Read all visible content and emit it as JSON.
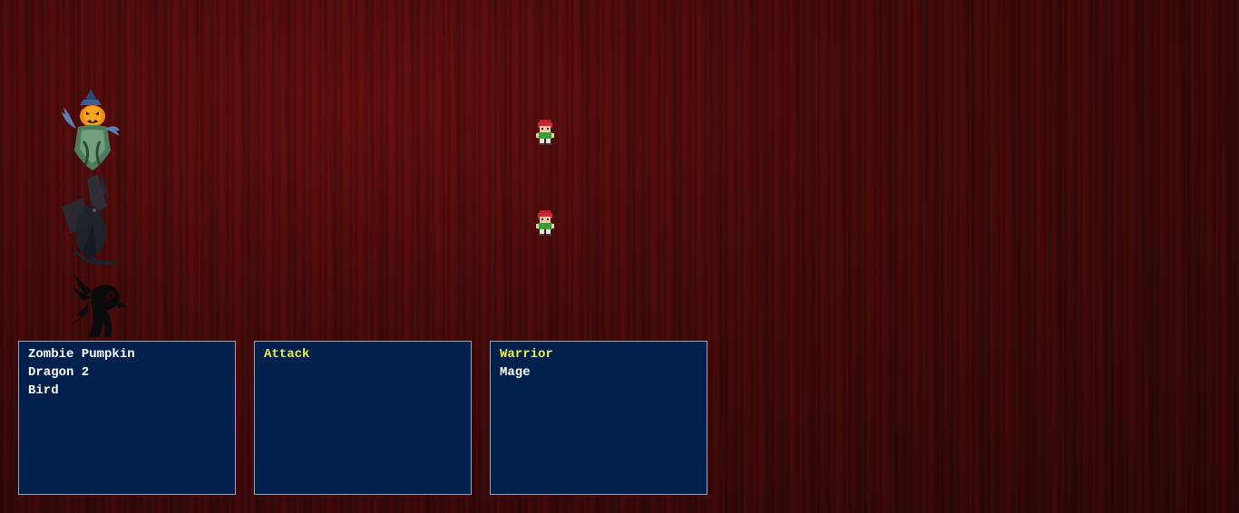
{
  "enemies": [
    {
      "name": "Zombie Pumpkin",
      "icon": "zombie-pumpkin-sprite"
    },
    {
      "name": "Dragon 2",
      "icon": "dragon-sprite"
    },
    {
      "name": "Bird",
      "icon": "bird-sprite"
    }
  ],
  "commands": [
    {
      "label": "Attack",
      "selected": true
    }
  ],
  "party": [
    {
      "name": "Warrior",
      "selected": true,
      "icon": "hero-sprite"
    },
    {
      "name": "Mage",
      "selected": false,
      "icon": "hero-sprite"
    }
  ],
  "colors": {
    "window_bg": "#01204c",
    "window_border": "#9aa4b8",
    "text": "#ffffff",
    "selected_text": "#e8f04a",
    "background": "#3a0b0b"
  }
}
